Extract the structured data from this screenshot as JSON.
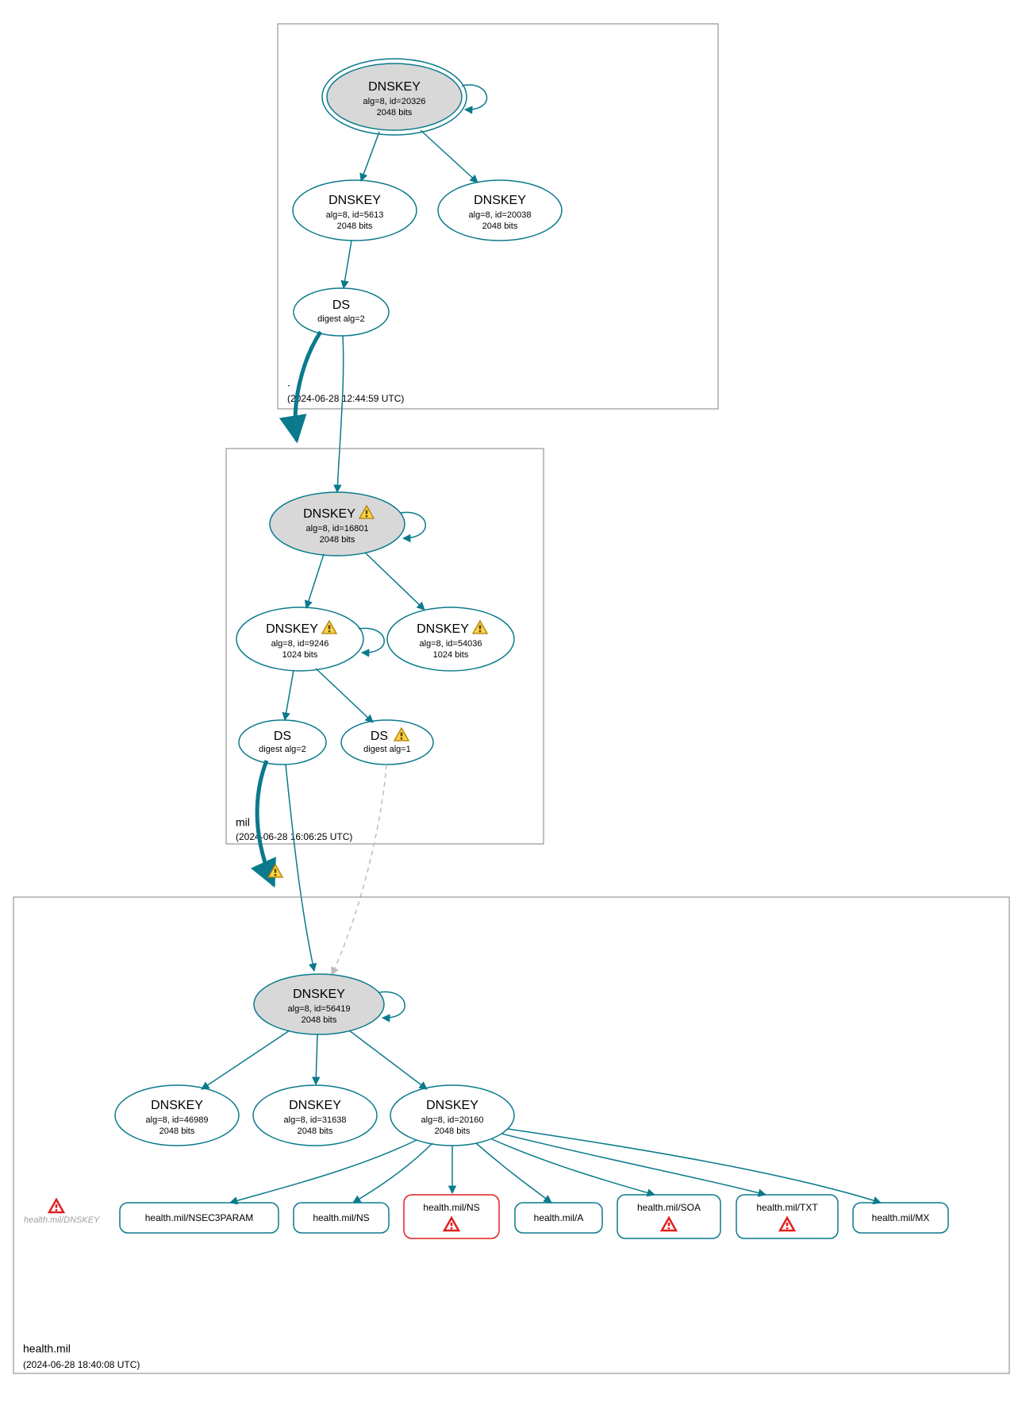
{
  "zones": {
    "root": {
      "name": ".",
      "timestamp": "(2024-06-28 12:44:59 UTC)"
    },
    "mil": {
      "name": "mil",
      "timestamp": "(2024-06-28 16:06:25 UTC)"
    },
    "health": {
      "name": "health.mil",
      "timestamp": "(2024-06-28 18:40:08 UTC)"
    }
  },
  "nodes": {
    "root_ksk": {
      "title": "DNSKEY",
      "line2": "alg=8, id=20326",
      "line3": "2048 bits"
    },
    "root_zsk1": {
      "title": "DNSKEY",
      "line2": "alg=8, id=5613",
      "line3": "2048 bits"
    },
    "root_zsk2": {
      "title": "DNSKEY",
      "line2": "alg=8, id=20038",
      "line3": "2048 bits"
    },
    "root_ds": {
      "title": "DS",
      "line2": "digest alg=2"
    },
    "mil_ksk": {
      "title": "DNSKEY",
      "line2": "alg=8, id=16801",
      "line3": "2048 bits",
      "warn": true
    },
    "mil_zsk1": {
      "title": "DNSKEY",
      "line2": "alg=8, id=9246",
      "line3": "1024 bits",
      "warn": true
    },
    "mil_zsk2": {
      "title": "DNSKEY",
      "line2": "alg=8, id=54036",
      "line3": "1024 bits",
      "warn": true
    },
    "mil_ds1": {
      "title": "DS",
      "line2": "digest alg=2"
    },
    "mil_ds2": {
      "title": "DS",
      "line2": "digest alg=1",
      "warn": true
    },
    "h_ksk": {
      "title": "DNSKEY",
      "line2": "alg=8, id=56419",
      "line3": "2048 bits"
    },
    "h_z1": {
      "title": "DNSKEY",
      "line2": "alg=8, id=46989",
      "line3": "2048 bits"
    },
    "h_z2": {
      "title": "DNSKEY",
      "line2": "alg=8, id=31638",
      "line3": "2048 bits"
    },
    "h_z3": {
      "title": "DNSKEY",
      "line2": "alg=8, id=20160",
      "line3": "2048 bits"
    }
  },
  "rrsets": {
    "orphan": {
      "label": "health.mil/DNSKEY",
      "err": true
    },
    "nsec3param": {
      "label": "health.mil/NSEC3PARAM"
    },
    "ns1": {
      "label": "health.mil/NS"
    },
    "ns2": {
      "label": "health.mil/NS",
      "err": true
    },
    "a": {
      "label": "health.mil/A"
    },
    "soa": {
      "label": "health.mil/SOA",
      "err": true
    },
    "txt": {
      "label": "health.mil/TXT",
      "err": true
    },
    "mx": {
      "label": "health.mil/MX"
    }
  },
  "colors": {
    "teal": "#0a7a8c",
    "red": "#e02020",
    "warn_fill": "#ffd24a",
    "warn_stroke": "#b08000"
  }
}
